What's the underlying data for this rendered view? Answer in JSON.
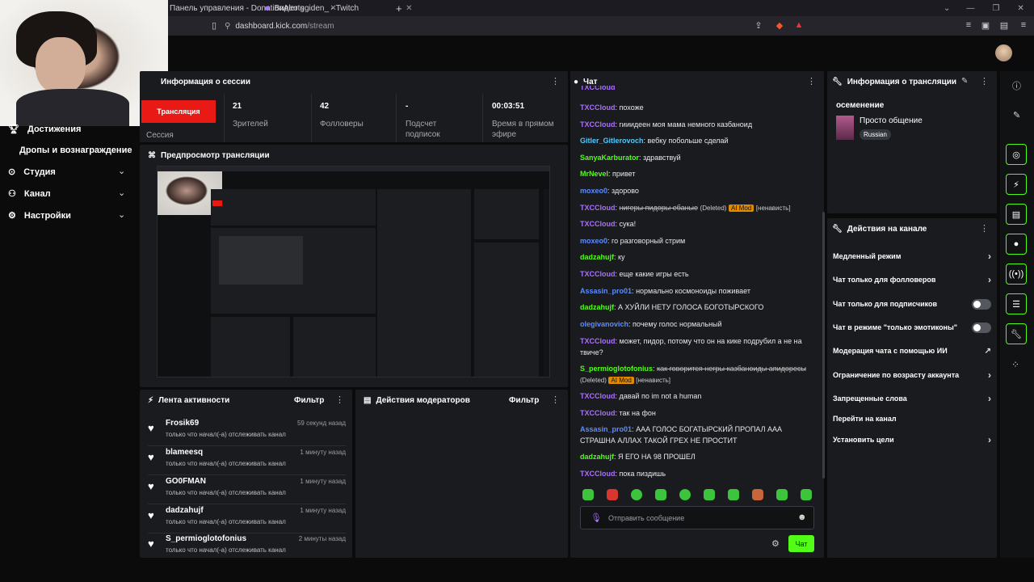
{
  "browser": {
    "tabs": [
      {
        "label": "Панель управления - DonationAlerts"
      },
      {
        "label": "Видео ggiden_ - Twitch"
      }
    ],
    "new_tab": "+",
    "url_domain": "dashboard.kick.com",
    "url_path": "/stream"
  },
  "sidebar": {
    "items": [
      {
        "label": "Достижения",
        "icon": "trophy-icon"
      },
      {
        "label": "Дропы и вознаграждение"
      },
      {
        "label": "Студия",
        "icon": "studio-icon"
      },
      {
        "label": "Канал",
        "icon": "channel-icon"
      },
      {
        "label": "Настройки",
        "icon": "gear-icon"
      }
    ]
  },
  "session": {
    "title": "Информация о сессии",
    "live_label": "Трансляция",
    "session_label": "Сессия",
    "stats": [
      {
        "value": "21",
        "label": "Зрителей"
      },
      {
        "value": "42",
        "label": "Фолловеры"
      },
      {
        "value": "-",
        "label": "Подсчет подписок"
      },
      {
        "value": "00:03:51",
        "label": "Время в прямом эфире"
      }
    ]
  },
  "preview": {
    "title": "Предпросмотр трансляции"
  },
  "activity": {
    "title": "Лента активности",
    "filter": "Фильтр",
    "items": [
      {
        "name": "Frosik69",
        "time": "59 секунд назад",
        "text": "только что начал(-а) отслеживать канал"
      },
      {
        "name": "blameesq",
        "time": "1 минуту назад",
        "text": "только что начал(-а) отслеживать канал"
      },
      {
        "name": "GO0FMAN",
        "time": "1 минуту назад",
        "text": "только что начал(-а) отслеживать канал"
      },
      {
        "name": "dadzahujf",
        "time": "1 минуту назад",
        "text": "только что начал(-а) отслеживать канал"
      },
      {
        "name": "S_permioglotofonius",
        "time": "2 минуты назад",
        "text": "только что начал(-а) отслеживать канал"
      }
    ]
  },
  "moderators": {
    "title": "Действия модераторов",
    "filter": "Фильтр"
  },
  "chat": {
    "title": "Чат",
    "messages": [
      {
        "user": "TXCCloud",
        "text": "похоже",
        "color": "#a970ff"
      },
      {
        "user": "TXCCloud",
        "text": "гииидеен моя мама немного казбаноид",
        "color": "#a970ff"
      },
      {
        "user": "Gitler_Gitlerovoch",
        "text": "вебку побольше сделай",
        "color": "#4ec9ff"
      },
      {
        "user": "SanyaKarburator",
        "text": "здравствуй",
        "color": "#53fc18"
      },
      {
        "user": "MrNevel",
        "text": "привет",
        "color": "#53fc18"
      },
      {
        "user": "moxeo0",
        "text": "здорово",
        "color": "#5b8cff"
      },
      {
        "user": "TXCCloud",
        "text": "нигеры пидоры ебаные",
        "color": "#a970ff",
        "deleted": "(Deleted)",
        "badge": "AI Mod",
        "reason": "[ненависть]"
      },
      {
        "user": "TXCCloud",
        "text": "сука!",
        "color": "#a970ff"
      },
      {
        "user": "moxeo0",
        "text": "го разговорный стрим",
        "color": "#5b8cff"
      },
      {
        "user": "dadzahujf",
        "text": "ку",
        "color": "#53fc18"
      },
      {
        "user": "TXCCloud",
        "text": "еще какие игры есть",
        "color": "#a970ff"
      },
      {
        "user": "Assasin_pro01",
        "text": "нормально космоноиды поживает",
        "color": "#5b8cff"
      },
      {
        "user": "dadzahujf",
        "text": "А ХУЙЛИ НЕТУ ГОЛОСА БОГОТЫРСКОГО",
        "color": "#53fc18"
      },
      {
        "user": "olegivanovich",
        "text": "почему голос нормальный",
        "color": "#5b8cff"
      },
      {
        "user": "TXCCloud",
        "text": "может, пидор, потому что он на кике подрубил а не на твиче?",
        "color": "#a970ff"
      },
      {
        "user": "S_permioglotofonius",
        "text": "как говорится негры казбаноиды апидоресы",
        "color": "#53fc18",
        "deleted": "(Deleted)",
        "badge": "AI Mod",
        "reason": "[ненависть]"
      },
      {
        "user": "TXCCloud",
        "text": "давай по im not a human",
        "color": "#a970ff"
      },
      {
        "user": "TXCCloud",
        "text": "так на фон",
        "color": "#a970ff"
      },
      {
        "user": "Assasin_pro01",
        "text": "ААА ГОЛОС БОГАТЫРСКИЙ ПРОПАЛ ААА СТРАШНА АЛЛАХ ТАКОЙ ГРЕХ НЕ ПРОСТИТ",
        "color": "#5b8cff"
      },
      {
        "user": "dadzahujf",
        "text": "Я ЕГО НА 98 ПРОШЕЛ",
        "color": "#53fc18"
      },
      {
        "user": "TXCCloud",
        "text": "пока пиздишь",
        "color": "#a970ff"
      }
    ],
    "input_placeholder": "Отправить сообщение",
    "send_label": "Чат"
  },
  "stream_info": {
    "title": "Информация о трансляции",
    "stream_title": "осеменение",
    "category": "Просто общение",
    "language": "Russian"
  },
  "channel_actions": {
    "title": "Действия на канале",
    "items": [
      {
        "label": "Медленный режим",
        "control": "arrow"
      },
      {
        "label": "Чат только для фолловеров",
        "control": "arrow"
      },
      {
        "label": "Чат только для подписчиков",
        "control": "toggle"
      },
      {
        "label": "Чат в режиме \"только эмотиконы\"",
        "control": "toggle"
      },
      {
        "label": "Модерация чата с помощью ИИ",
        "control": "external"
      },
      {
        "label": "Ограничение по возрасту аккаунта",
        "control": "arrow"
      },
      {
        "label": "Запрещенные слова",
        "control": "arrow"
      },
      {
        "label": "Перейти на канал",
        "control": "none"
      },
      {
        "label": "Установить цели",
        "control": "arrow"
      }
    ]
  },
  "colors": {
    "accent": "#53fc18",
    "live_red": "#e91916",
    "panel": "#191b1f"
  }
}
